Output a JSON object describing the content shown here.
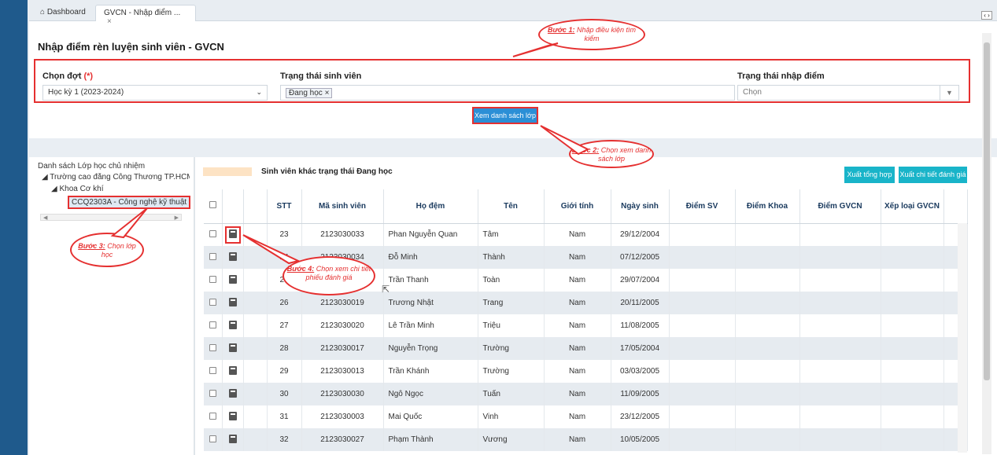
{
  "tabs": [
    {
      "label": "Dashboard",
      "icon": "home-icon"
    },
    {
      "label": "GVCN - Nhập điểm ...",
      "close": "×"
    }
  ],
  "page_title": "Nhập điểm rèn luyện sinh viên - GVCN",
  "filters": {
    "dot_label": "Chọn đợt",
    "dot_required": "(*)",
    "dot_value": "Học kỳ 1 (2023-2024)",
    "status_label": "Trạng thái sinh viên",
    "status_chip": "Đang học",
    "entry_label": "Trạng thái nhập điểm",
    "entry_placeholder": "Chọn"
  },
  "view_button": "Xem danh sách lớp",
  "tree": {
    "title": "Danh sách Lớp học chủ nhiệm",
    "school": "Trường cao đẳng Công Thương TP.HCM",
    "faculty": "Khoa Cơ khí",
    "class": "CCQ2303A - Công nghệ kỹ thuật"
  },
  "legend_text": "Sinh viên khác trạng thái Đang học",
  "buttons": {
    "export_summary": "Xuất tổng hợp",
    "export_detail": "Xuất chi tiết đánh giá"
  },
  "table": {
    "headers": [
      "STT",
      "Mã sinh viên",
      "Họ đệm",
      "Tên",
      "Giới tính",
      "Ngày sinh",
      "Điểm SV",
      "Điểm Khoa",
      "Điểm GVCN",
      "Xếp loại GVCN"
    ],
    "rows": [
      {
        "stt": "23",
        "id": "2123030033",
        "ho": "Phan Nguyễn Quan",
        "ten": "Tâm",
        "gt": "Nam",
        "ns": "29/12/2004"
      },
      {
        "stt": "24",
        "id": "2123030034",
        "ho": "Đỗ Minh",
        "ten": "Thành",
        "gt": "Nam",
        "ns": "07/12/2005"
      },
      {
        "stt": "25",
        "id": "2123030035",
        "ho": "Trần Thanh",
        "ten": "Toàn",
        "gt": "Nam",
        "ns": "29/07/2004"
      },
      {
        "stt": "26",
        "id": "2123030019",
        "ho": "Trương Nhật",
        "ten": "Trang",
        "gt": "Nam",
        "ns": "20/11/2005"
      },
      {
        "stt": "27",
        "id": "2123030020",
        "ho": "Lê Trần Minh",
        "ten": "Triệu",
        "gt": "Nam",
        "ns": "11/08/2005"
      },
      {
        "stt": "28",
        "id": "2123030017",
        "ho": "Nguyễn Trọng",
        "ten": "Trường",
        "gt": "Nam",
        "ns": "17/05/2004"
      },
      {
        "stt": "29",
        "id": "2123030013",
        "ho": "Trần Khánh",
        "ten": "Trường",
        "gt": "Nam",
        "ns": "03/03/2005"
      },
      {
        "stt": "30",
        "id": "2123030030",
        "ho": "Ngô Ngọc",
        "ten": "Tuấn",
        "gt": "Nam",
        "ns": "11/09/2005"
      },
      {
        "stt": "31",
        "id": "2123030003",
        "ho": "Mai Quốc",
        "ten": "Vinh",
        "gt": "Nam",
        "ns": "23/12/2005"
      },
      {
        "stt": "32",
        "id": "2123030027",
        "ho": "Phạm Thành",
        "ten": "Vương",
        "gt": "Nam",
        "ns": "10/05/2005"
      }
    ]
  },
  "callouts": {
    "step1_title": "Bước 1:",
    "step1_text": "Nhập điều kiện tìm kiếm",
    "step2_title": "Bước 2:",
    "step2_text": "Chọn xem danh sách lớp",
    "step3_title": "Bước 3:",
    "step3_text": "Chọn lớp học",
    "step4_title": "Bước 4:",
    "step4_text": "Chọn xem chi tiết phiếu đánh giá"
  },
  "colors": {
    "accent": "#2b8fd6",
    "annotation": "#e53030",
    "export": "#19b4c9",
    "legend": "#fde3c4"
  }
}
